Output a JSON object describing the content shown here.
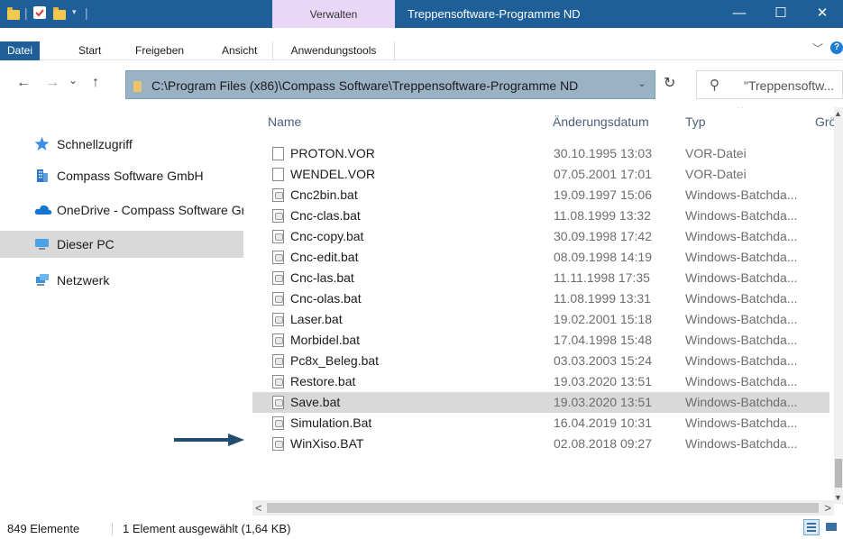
{
  "titlebar": {
    "context_tab": "Verwalten",
    "title": "Treppensoftware-Programme ND",
    "minimize": "—",
    "maximize": "☐",
    "close": "✕"
  },
  "ribbon": {
    "tabs": [
      "Datei",
      "Start",
      "Freigeben",
      "Ansicht",
      "Anwendungstools"
    ],
    "help": "?"
  },
  "nav": {
    "back": "←",
    "forward": "→",
    "recent": "⌄",
    "up": "↑",
    "address": "C:\\Program Files (x86)\\Compass Software\\Treppensoftware-Programme ND",
    "refresh": "↻",
    "search_placeholder": "\"Treppensoftw..."
  },
  "sidebar": {
    "items": [
      {
        "label": "Schnellzugriff",
        "icon": "star-icon"
      },
      {
        "label": "Compass Software GmbH",
        "icon": "building-icon"
      },
      {
        "label": "OneDrive - Compass Software Gr",
        "icon": "cloud-icon"
      },
      {
        "label": "Dieser PC",
        "icon": "computer-icon",
        "selected": true
      },
      {
        "label": "Netzwerk",
        "icon": "network-icon"
      }
    ]
  },
  "columns": {
    "name": "Name",
    "date": "Änderungsdatum",
    "type": "Typ",
    "size": "Grö"
  },
  "files": [
    {
      "name": "PROTON.VOR",
      "date": "30.10.1995 13:03",
      "type": "VOR-Datei",
      "kind": "doc"
    },
    {
      "name": "WENDEL.VOR",
      "date": "07.05.2001 17:01",
      "type": "VOR-Datei",
      "kind": "doc"
    },
    {
      "name": "Cnc2bin.bat",
      "date": "19.09.1997 15:06",
      "type": "Windows-Batchda...",
      "kind": "bat"
    },
    {
      "name": "Cnc-clas.bat",
      "date": "11.08.1999 13:32",
      "type": "Windows-Batchda...",
      "kind": "bat"
    },
    {
      "name": "Cnc-copy.bat",
      "date": "30.09.1998 17:42",
      "type": "Windows-Batchda...",
      "kind": "bat"
    },
    {
      "name": "Cnc-edit.bat",
      "date": "08.09.1998 14:19",
      "type": "Windows-Batchda...",
      "kind": "bat"
    },
    {
      "name": "Cnc-las.bat",
      "date": "11.11.1998 17:35",
      "type": "Windows-Batchda...",
      "kind": "bat"
    },
    {
      "name": "Cnc-olas.bat",
      "date": "11.08.1999 13:31",
      "type": "Windows-Batchda...",
      "kind": "bat"
    },
    {
      "name": "Laser.bat",
      "date": "19.02.2001 15:18",
      "type": "Windows-Batchda...",
      "kind": "bat"
    },
    {
      "name": "Morbidel.bat",
      "date": "17.04.1998 15:48",
      "type": "Windows-Batchda...",
      "kind": "bat"
    },
    {
      "name": "Pc8x_Beleg.bat",
      "date": "03.03.2003 15:24",
      "type": "Windows-Batchda...",
      "kind": "bat"
    },
    {
      "name": "Restore.bat",
      "date": "19.03.2020 13:51",
      "type": "Windows-Batchda...",
      "kind": "bat"
    },
    {
      "name": "Save.bat",
      "date": "19.03.2020 13:51",
      "type": "Windows-Batchda...",
      "kind": "bat",
      "selected": true
    },
    {
      "name": "Simulation.Bat",
      "date": "16.04.2019 10:31",
      "type": "Windows-Batchda...",
      "kind": "bat"
    },
    {
      "name": "WinXiso.BAT",
      "date": "02.08.2018 09:27",
      "type": "Windows-Batchda...",
      "kind": "bat"
    }
  ],
  "status": {
    "count": "849 Elemente",
    "selection": "1 Element ausgewählt (1,64 KB)"
  },
  "colors": {
    "title_bg": "#1f5f99",
    "context_tab_bg": "#e8d7f7",
    "address_bg": "#9ab2c3",
    "selection_bg": "#d9d9d9",
    "arrow": "#1f4e6e"
  }
}
